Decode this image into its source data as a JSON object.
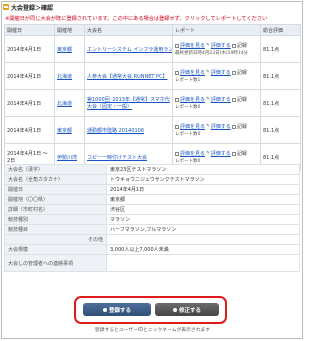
{
  "header": {
    "title": "大会登録＞確認",
    "notice": "※開催日が同じ大会が既に登録されています。この中にある場合は登録せず、クリックしてレポートしてください"
  },
  "events_table": {
    "columns": [
      "開催日",
      "開催地",
      "大会名",
      "レポート",
      "総合評価"
    ],
    "rows": [
      {
        "date": "2014年4月1日",
        "place": "東京都",
        "name": "エントリーシステム インフラ運用ラン",
        "eval_label": "評価を見る",
        "report_label": "評価する",
        "record_label": "記録",
        "note": "最終更新日時4月23日(木)19時14分",
        "score": "81.1点"
      },
      {
        "date": "2014年4月1日",
        "place": "北海道",
        "name": "人参大会【通常大会 RUNNET PC】",
        "eval_label": "評価を見る",
        "report_label": "評価する",
        "record_label": "記録",
        "note": "レポート数1",
        "score": "81.1点"
      },
      {
        "date": "2014年4月1日",
        "place": "北海道",
        "name": "第1000回_2013年【通常】スマホ代大会（固定・一般）",
        "eval_label": "評価を見る",
        "report_label": "評価する",
        "record_label": "記録",
        "note": "レポート数0",
        "score": "81.1点"
      },
      {
        "date": "2014年4月1日",
        "place": "東京都",
        "name": "通勤都市陸路 20140106",
        "eval_label": "評価を見る",
        "report_label": "評価する",
        "record_label": "記録",
        "note": "レポート数0",
        "score": "81.1点"
      },
      {
        "date": "2014年4月1日 ～ 2日",
        "place": "伊勢川湾",
        "name": "コピー一時付けテスト大会",
        "eval_label": "評価を見る",
        "report_label": "評価する",
        "record_label": "記録",
        "note": "レポート数0",
        "score": "81.1点"
      }
    ]
  },
  "details": {
    "rows": [
      {
        "label": "大会名（漢字）",
        "value": "東京23区テストマラソン"
      },
      {
        "label": "大会名（全角カタカナ）",
        "value": "トウキョウニジュウサンクテストマラソン"
      },
      {
        "label": "開催日",
        "value": "2014年4月1日"
      },
      {
        "label": "開催地（〇〇県）",
        "value": "東京都"
      },
      {
        "label": "詳細（市町村名）",
        "value": "渋谷区"
      },
      {
        "label": "競技種別",
        "value": "マラソン"
      },
      {
        "label": "競技種目",
        "value": "ハーフマラソン,フルマラソン"
      },
      {
        "label": "その他",
        "value": ""
      },
      {
        "label": "大会規模",
        "value": "3,000人以上7,000人未満"
      },
      {
        "label": "大会しの管理者への連絡事項",
        "value": ""
      }
    ]
  },
  "actions": {
    "register_label": "登録する",
    "edit_label": "修正する",
    "footer_note": "登録するとユーザーIDとニックネームが表示されます"
  },
  "colors": {
    "highlight": "#e01b1b",
    "link": "#1a56c2",
    "notice": "#d0021b"
  }
}
